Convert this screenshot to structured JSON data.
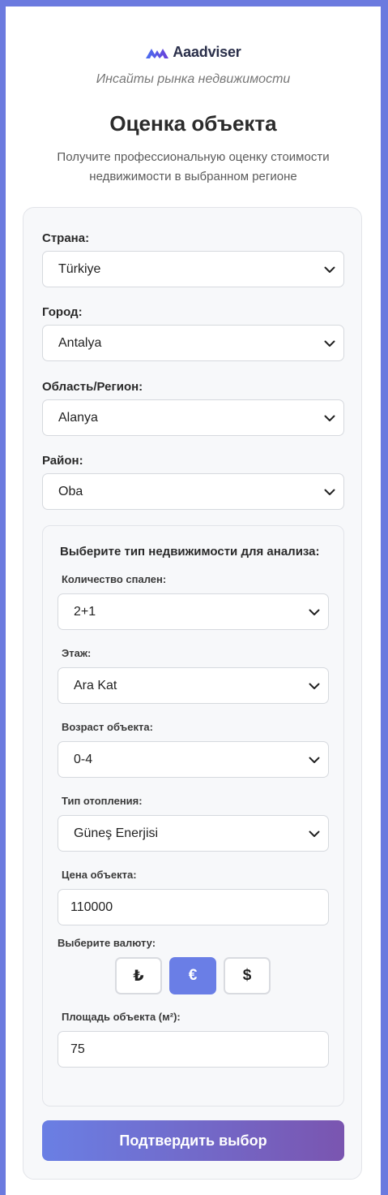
{
  "brand": {
    "name": "Aaadviser",
    "tagline": "Инсайты рынка недвижимости"
  },
  "header": {
    "title": "Оценка объекта",
    "subtitle": "Получите профессиональную оценку стоимости недвижимости в выбранном регионе"
  },
  "location": {
    "country_label": "Страна:",
    "country_value": "Türkiye",
    "city_label": "Город:",
    "city_value": "Antalya",
    "region_label": "Область/Регион:",
    "region_value": "Alanya",
    "district_label": "Район:",
    "district_value": "Oba"
  },
  "property": {
    "section_title": "Выберите тип недвижимости для анализа:",
    "bedrooms_label": "Количество спален:",
    "bedrooms_value": "2+1",
    "floor_label": "Этаж:",
    "floor_value": "Ara Kat",
    "age_label": "Возраст объекта:",
    "age_value": "0-4",
    "heating_label": "Тип отопления:",
    "heating_value": "Güneş Enerjisi",
    "price_label": "Цена объекта:",
    "price_value": "110000",
    "currency_label": "Выберите валюту:",
    "currencies": [
      "₺",
      "€",
      "$"
    ],
    "selected_currency": "€",
    "area_label": "Площадь объекта (м²):",
    "area_value": "75"
  },
  "actions": {
    "submit_label": "Подтвердить выбор"
  },
  "colors": {
    "accent": "#6a7ee6",
    "page_bg": "#6b7adf",
    "gradient_end": "#7a55b0"
  },
  "icons": {
    "select_arrow": "chevron-down-icon",
    "logo": "logo-icon"
  }
}
